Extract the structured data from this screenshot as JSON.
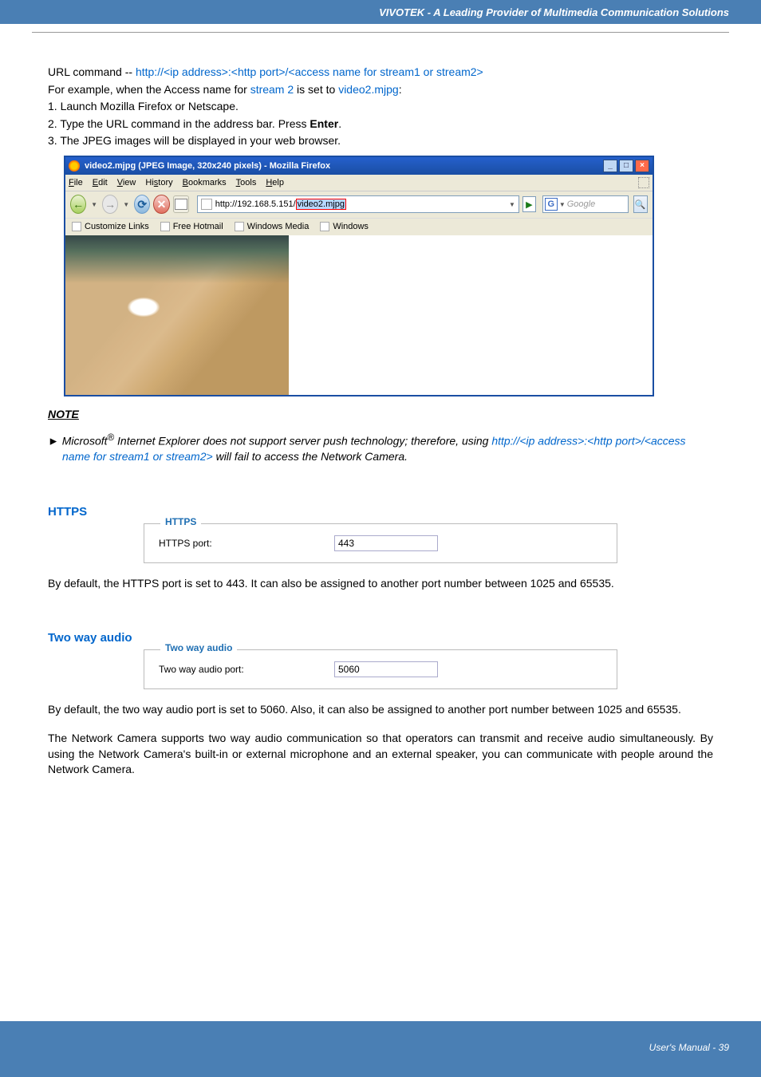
{
  "header": {
    "tagline": "VIVOTEK - A Leading Provider of Multimedia Communication Solutions"
  },
  "url_cmd": {
    "prefix": "URL command -- ",
    "pattern": "http://<ip address>:<http port>/<access name for stream1 or stream2>",
    "line2_a": "For example, when the Access name for ",
    "line2_stream": "stream 2",
    "line2_b": " is set to ",
    "line2_val": "video2.mjpg",
    "line2_c": ":",
    "step1": "1. Launch Mozilla Firefox or Netscape.",
    "step2a": "2. Type the URL command in the address bar. Press ",
    "step2b": "Enter",
    "step2c": ".",
    "step3": "3. The JPEG images will be displayed in your web browser."
  },
  "browser": {
    "title": "video2.mjpg (JPEG Image, 320x240 pixels) - Mozilla Firefox",
    "menus": [
      "File",
      "Edit",
      "View",
      "History",
      "Bookmarks",
      "Tools",
      "Help"
    ],
    "url_prefix": "http://192.168.5.151/",
    "url_hl": "video2.mjpg",
    "search_engine": "G",
    "search_placeholder": "Google",
    "bookmarks": [
      "Customize Links",
      "Free Hotmail",
      "Windows Media",
      "Windows"
    ]
  },
  "note": {
    "heading": "NOTE",
    "arrow": "►",
    "a": " Microsoft",
    "sup": "®",
    "b": " Internet Explorer does not support server push technology; therefore, using ",
    "link": "http://<ip address>:<http port>/<access name for stream1 or stream2>",
    "c": " will fail to access the Network Camera."
  },
  "https": {
    "heading": "HTTPS",
    "legend": "HTTPS",
    "label": "HTTPS port:",
    "value": "443",
    "body": "By default, the HTTPS port is set to 443. It can also be assigned to another port number between 1025 and 65535."
  },
  "twoway": {
    "heading": "Two way audio",
    "legend": "Two way audio",
    "label": "Two way audio port:",
    "value": "5060",
    "body1": "By default, the two way audio port is set to 5060. Also, it can also be assigned to another port number between 1025 and 65535.",
    "body2": "The Network Camera supports two way audio communication so that operators can transmit and receive audio simultaneously. By using the Network Camera's built-in or external microphone and an external speaker, you can communicate with people around the Network Camera."
  },
  "footer": {
    "text": "User's Manual - 39"
  }
}
